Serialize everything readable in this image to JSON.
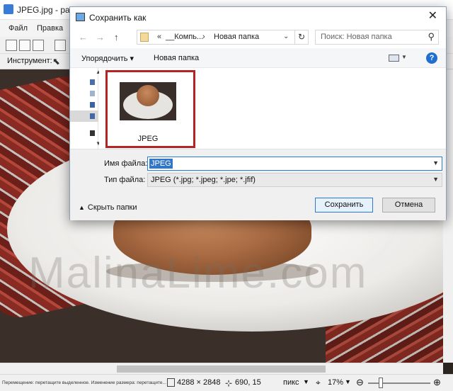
{
  "bg_window": {
    "title": "JPEG.jpg - paint.n",
    "menus": [
      "Файл",
      "Правка"
    ],
    "tool_label": "Инструмент:",
    "watermark": "MalinaLime.com"
  },
  "status": {
    "hint": "Перемещение: перетащите выделенное. Изменение размера: перетащите...",
    "image_size": "4288 × 2848",
    "cursor_pos": "690, 15",
    "unit": "пикс",
    "zoom": "17%",
    "zoom_slider_fraction": 0.2
  },
  "dialog": {
    "title": "Сохранить как",
    "close": "✕",
    "nav": {
      "back": "←",
      "forward": "→",
      "up": "↑"
    },
    "address": {
      "overflow": "«",
      "segments": [
        "__Компь...",
        "Новая папка"
      ],
      "separator": "›"
    },
    "refresh": "↻",
    "search_placeholder": "Поиск: Новая папка",
    "toolbar": {
      "organize": "Упорядочить ▾",
      "new_folder": "Новая папка",
      "help": "?"
    },
    "files": [
      {
        "name": "JPEG",
        "selected": true
      }
    ],
    "form": {
      "filename_label": "Имя файла:",
      "filename_value": "JPEG",
      "filetype_label": "Тип файла:",
      "filetype_value": "JPEG (*.jpg; *.jpeg; *.jpe; *.jfif)"
    },
    "hide_folders": "Скрыть папки",
    "save_button": "Сохранить",
    "cancel_button": "Отмена"
  },
  "colors": {
    "highlight_frame": "#b52424",
    "primary_button_border": "#2c78d4",
    "selection_bg": "#3276c8"
  }
}
